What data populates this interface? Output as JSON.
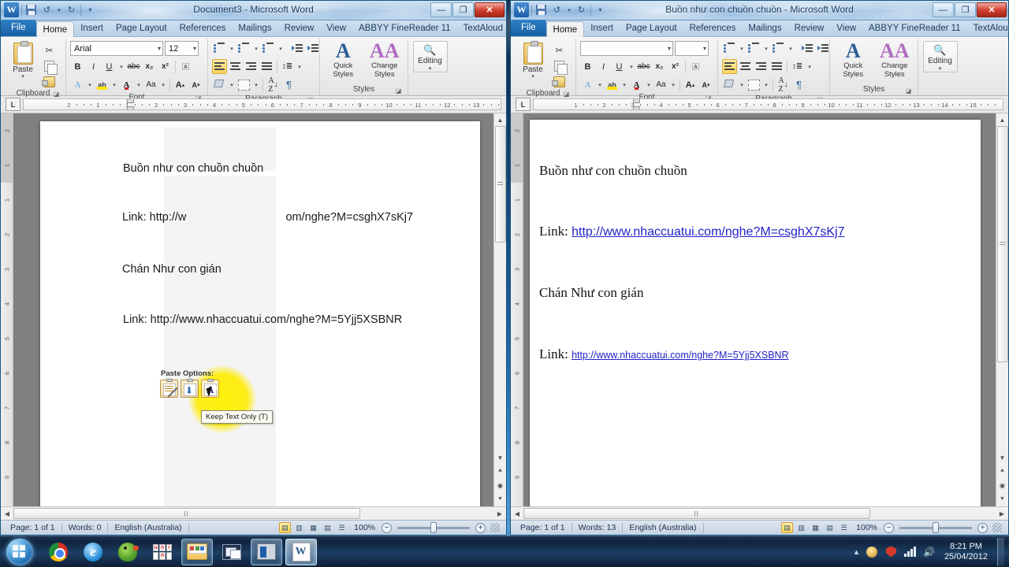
{
  "desktop": {
    "taskbar": {
      "start_label": "Start",
      "items": [
        {
          "name": "google-chrome",
          "label": "Google Chrome",
          "state": "pinned"
        },
        {
          "name": "internet-explorer",
          "label": "Internet Explorer",
          "state": "pinned"
        },
        {
          "name": "parrot-app",
          "label": "Parrot",
          "state": "pinned"
        },
        {
          "name": "unikey",
          "label": "UniKey",
          "state": "pinned"
        },
        {
          "name": "windows-explorer",
          "label": "Windows Explorer",
          "state": "open"
        },
        {
          "name": "screen-recorder",
          "label": "Screen Recorder",
          "state": "pinned"
        },
        {
          "name": "media-player",
          "label": "Media Player",
          "state": "open"
        },
        {
          "name": "microsoft-word",
          "label": "Microsoft Word",
          "state": "active"
        }
      ],
      "tray": {
        "show_hidden": "▲",
        "icons": [
          "smiley-icon",
          "security-shield-icon",
          "network-signal-icon",
          "volume-icon"
        ],
        "time": "8:21 PM",
        "date": "25/04/2012"
      }
    }
  },
  "windows": [
    {
      "id": "win-left",
      "title": "Document3  -  Microsoft Word",
      "quick_access": {
        "app_icon": "word-icon",
        "save_label": "Save",
        "undo_label": "Undo",
        "redo_label": "Redo",
        "customize_label": "Customize Quick Access Toolbar"
      },
      "window_buttons": {
        "minimize": "—",
        "maximize": "❐",
        "close": "✕"
      },
      "tabs": {
        "file": "File",
        "items": [
          "Home",
          "Insert",
          "Page Layout",
          "References",
          "Mailings",
          "Review",
          "View",
          "ABBYY FineReader 11",
          "TextAloud"
        ],
        "active": "Home",
        "help_label": "?",
        "collapse_label": "⌃"
      },
      "ribbon": {
        "groups": [
          {
            "label": "Clipboard",
            "buttons": [
              "Paste",
              "Cut",
              "Copy",
              "Format Painter"
            ]
          },
          {
            "label": "Font",
            "font_name": "Arial",
            "font_size": "12",
            "buttons": [
              "Bold",
              "Italic",
              "Underline",
              "Strikethrough",
              "Subscript",
              "Superscript",
              "Text Effects",
              "Text Highlight Color",
              "Font Color",
              "Change Case",
              "Grow Font",
              "Shrink Font"
            ]
          },
          {
            "label": "Paragraph",
            "buttons": [
              "Bullets",
              "Numbering",
              "Multilevel List",
              "Decrease Indent",
              "Increase Indent",
              "Align Left",
              "Center",
              "Align Right",
              "Justify",
              "Line Spacing",
              "Shading",
              "Borders",
              "Sort",
              "Show/Hide"
            ]
          },
          {
            "label": "Styles",
            "buttons": [
              "Quick Styles",
              "Change Styles"
            ]
          },
          {
            "label": "Editing",
            "buttons": [
              "Editing"
            ]
          }
        ]
      },
      "ruler": {
        "tab_stop": "L",
        "horizontal_labels": [
          "2",
          "1",
          "1",
          "2",
          "3",
          "4",
          "5",
          "6",
          "7",
          "8",
          "9",
          "10",
          "11",
          "12",
          "13"
        ],
        "vertical_labels": [
          "2",
          "1",
          "1",
          "2",
          "3",
          "4",
          "5",
          "6",
          "7",
          "8",
          "9",
          "10"
        ]
      },
      "document": {
        "lines": [
          {
            "text": "Buồn như con chuồn chuồn",
            "style": "plain"
          },
          {
            "prefix": "Link: http://w",
            "suffix": "om/nghe?M=csghX7sKj7",
            "style": "split"
          },
          {
            "text": "Chán Như con gián",
            "style": "plain"
          },
          {
            "text": "Link: http://www.nhaccuatui.com/nghe?M=5Yjj5XSBNR",
            "style": "plain"
          }
        ]
      },
      "paste_options": {
        "title": "Paste Options:",
        "buttons": [
          {
            "name": "keep-source-formatting",
            "label": "Keep Source Formatting (K)"
          },
          {
            "name": "merge-formatting",
            "label": "Merge Formatting (M)"
          },
          {
            "name": "keep-text-only",
            "label": "Keep Text Only (T)"
          }
        ],
        "selected_index": 2,
        "tooltip": "Keep Text Only (T)",
        "highlight_color": "#ffec00"
      },
      "status_bar": {
        "page": "Page: 1 of 1",
        "words": "Words: 0",
        "language": "English (Australia)",
        "views": [
          "Print Layout",
          "Full Screen Reading",
          "Web Layout",
          "Outline",
          "Draft"
        ],
        "active_view": "Print Layout",
        "zoom": "100%",
        "zoom_out": "−",
        "zoom_in": "+"
      }
    },
    {
      "id": "win-right",
      "title": "Buồn như con chuồn chuồn  -  Microsoft Word",
      "quick_access": {
        "app_icon": "word-icon",
        "save_label": "Save",
        "undo_label": "Undo",
        "redo_label": "Redo",
        "customize_label": "Customize Quick Access Toolbar"
      },
      "window_buttons": {
        "minimize": "—",
        "maximize": "❐",
        "close": "✕"
      },
      "tabs": {
        "file": "File",
        "items": [
          "Home",
          "Insert",
          "Page Layout",
          "References",
          "Mailings",
          "Review",
          "View",
          "ABBYY FineReader 11",
          "TextAloud"
        ],
        "active": "Home",
        "help_label": "?",
        "collapse_label": "⌃"
      },
      "ribbon": {
        "groups": [
          {
            "label": "Clipboard",
            "buttons": [
              "Paste",
              "Cut",
              "Copy",
              "Format Painter"
            ]
          },
          {
            "label": "Font",
            "font_name": "",
            "font_size": "",
            "buttons": [
              "Bold",
              "Italic",
              "Underline",
              "Strikethrough",
              "Subscript",
              "Superscript",
              "Text Effects",
              "Text Highlight Color",
              "Font Color",
              "Change Case",
              "Grow Font",
              "Shrink Font"
            ]
          },
          {
            "label": "Paragraph",
            "buttons": [
              "Bullets",
              "Numbering",
              "Multilevel List",
              "Decrease Indent",
              "Increase Indent",
              "Align Left",
              "Center",
              "Align Right",
              "Justify",
              "Line Spacing",
              "Shading",
              "Borders",
              "Sort",
              "Show/Hide"
            ]
          },
          {
            "label": "Styles",
            "buttons": [
              "Quick Styles",
              "Change Styles"
            ]
          },
          {
            "label": "Editing",
            "buttons": [
              "Editing"
            ]
          }
        ]
      },
      "ruler": {
        "tab_stop": "L",
        "horizontal_labels": [
          "1",
          "2",
          "3",
          "4",
          "5",
          "6",
          "7",
          "8",
          "9",
          "10",
          "11",
          "12",
          "13",
          "14",
          "15"
        ],
        "vertical_labels": [
          "2",
          "1",
          "1",
          "2",
          "3",
          "4",
          "5",
          "6",
          "7",
          "8",
          "9",
          "10"
        ]
      },
      "document": {
        "lines": [
          {
            "text": "Buồn như con chuồn chuồn",
            "style": "plain"
          },
          {
            "prefix": "Link: ",
            "link": "http://www.nhaccuatui.com/nghe?M=csghX7sKj7",
            "style": "link-large"
          },
          {
            "text": "Chán Như con gián",
            "style": "plain"
          },
          {
            "prefix": "Link: ",
            "link": "http://www.nhaccuatui.com/nghe?M=5Yjj5XSBNR",
            "style": "link-small"
          }
        ]
      },
      "status_bar": {
        "page": "Page: 1 of 1",
        "words": "Words: 13",
        "language": "English (Australia)",
        "views": [
          "Print Layout",
          "Full Screen Reading",
          "Web Layout",
          "Outline",
          "Draft"
        ],
        "active_view": "Print Layout",
        "zoom": "100%",
        "zoom_out": "−",
        "zoom_in": "+"
      }
    }
  ],
  "colors": {
    "accent_blue": "#1760a3",
    "link_blue": "#2222c8",
    "highlight_yellow": "#ffec00",
    "close_red": "#cf3b2a"
  }
}
